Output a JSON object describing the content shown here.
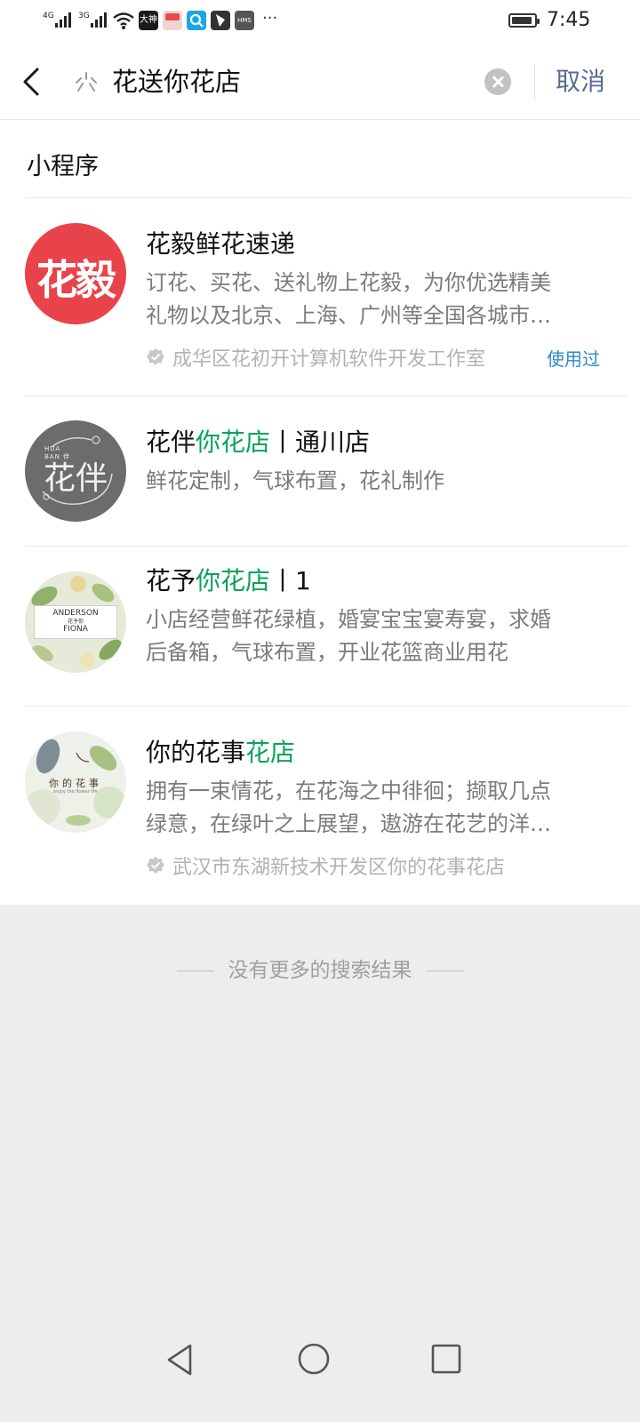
{
  "status_bar": {
    "network1": "4G",
    "network2": "3G",
    "time": "7:45",
    "battery_level": 0.9,
    "app_icons": [
      "dashen-icon",
      "gift-icon",
      "search-app-icon",
      "tag-icon",
      "hms-icon"
    ],
    "app_icon_texts": {
      "dashen": "大神",
      "hms": "HMS"
    },
    "more": "···"
  },
  "search": {
    "query": "花送你花店",
    "cancel_label": "取消"
  },
  "section": {
    "title": "小程序"
  },
  "results": [
    {
      "avatar_text": "花毅",
      "name_parts": [
        {
          "t": "花毅鲜花速递",
          "hl": false
        }
      ],
      "desc_lines": [
        "订花、买花、送礼物上花毅，为你优选精美",
        "礼物以及北京、上海、广州等全国各城市…"
      ],
      "developer": "成华区花初开计算机软件开发工作室",
      "used_label": "使用过"
    },
    {
      "avatar_text": "花伴",
      "avatar_subtext": "HUA BAN 伴",
      "name_parts": [
        {
          "t": "花伴",
          "hl": false
        },
        {
          "t": "你花店",
          "hl": true
        },
        {
          "t": "丨通川店",
          "hl": false
        }
      ],
      "desc_lines": [
        "鲜花定制，气球布置，花礼制作"
      ]
    },
    {
      "avatar_lines": [
        "ANDERSON",
        "花予你",
        "FIONA"
      ],
      "name_parts": [
        {
          "t": "花予",
          "hl": false
        },
        {
          "t": "你花店",
          "hl": true
        },
        {
          "t": "丨1",
          "hl": false
        }
      ],
      "desc_lines": [
        "小店经营鲜花绿植，婚宴宝宝宴寿宴，求婚",
        "后备箱，气球布置，开业花篮商业用花"
      ]
    },
    {
      "avatar_lines": [
        "你的花事",
        "enjoy the flower life"
      ],
      "name_parts": [
        {
          "t": "你的花事",
          "hl": false
        },
        {
          "t": "花店",
          "hl": true
        }
      ],
      "desc_lines": [
        "拥有一束情花，在花海之中徘徊；撷取几点",
        "绿意，在绿叶之上展望，遨游在花艺的洋…"
      ],
      "developer": "武汉市东湖新技术开发区你的花事花店"
    }
  ],
  "footer": {
    "no_more": "没有更多的搜索结果"
  },
  "colors": {
    "highlight": "#07a35a",
    "link": "#576b95",
    "used": "#2a8acb"
  }
}
